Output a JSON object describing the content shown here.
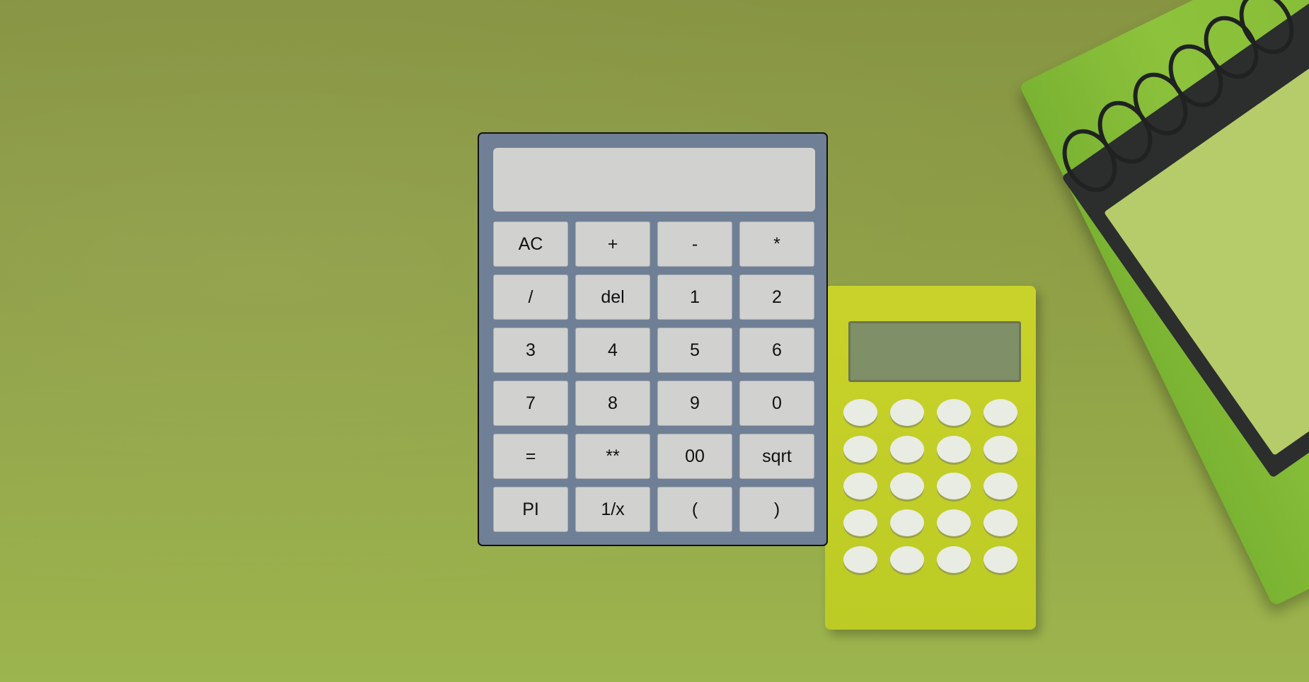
{
  "calculator": {
    "display_value": "",
    "keys": [
      "AC",
      "+",
      "-",
      "*",
      "/",
      "del",
      "1",
      "2",
      "3",
      "4",
      "5",
      "6",
      "7",
      "8",
      "9",
      "0",
      "=",
      "**",
      "00",
      "sqrt",
      "PI",
      "1/x",
      "(",
      ")"
    ]
  },
  "background": {
    "toy_calculator_keys": [
      "",
      "",
      "",
      "",
      "",
      "",
      "",
      "",
      "",
      "",
      "",
      "",
      "",
      "",
      "",
      "",
      "",
      "",
      "",
      ""
    ]
  },
  "colors": {
    "calculator_body": "#6f7f95",
    "key_face": "#d1d1cf",
    "background_green": "#8fa046"
  }
}
